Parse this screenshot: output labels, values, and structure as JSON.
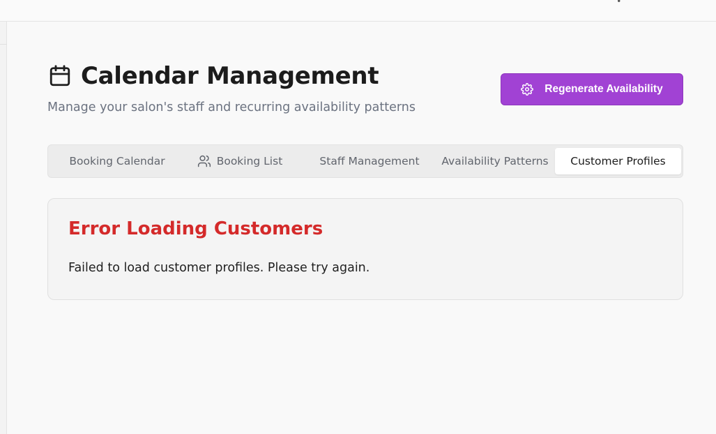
{
  "header": {
    "title": "Calendar Management",
    "subtitle": "Manage your salon's staff and recurring availability patterns",
    "calendar_icon": "calendar-icon"
  },
  "actions": {
    "regenerate_label": "Regenerate Availability",
    "regenerate_icon": "gear-icon",
    "accent_color": "#a142d4"
  },
  "tabs": [
    {
      "label": "Booking Calendar",
      "active": false
    },
    {
      "label": "Booking List",
      "active": false,
      "icon": "users-icon"
    },
    {
      "label": "Staff Management",
      "active": false
    },
    {
      "label": "Availability Patterns",
      "active": false
    },
    {
      "label": "Customer Profiles",
      "active": true
    }
  ],
  "error": {
    "title": "Error Loading Customers",
    "message": "Failed to load customer profiles. Please try again.",
    "title_color": "#d42a2a"
  }
}
